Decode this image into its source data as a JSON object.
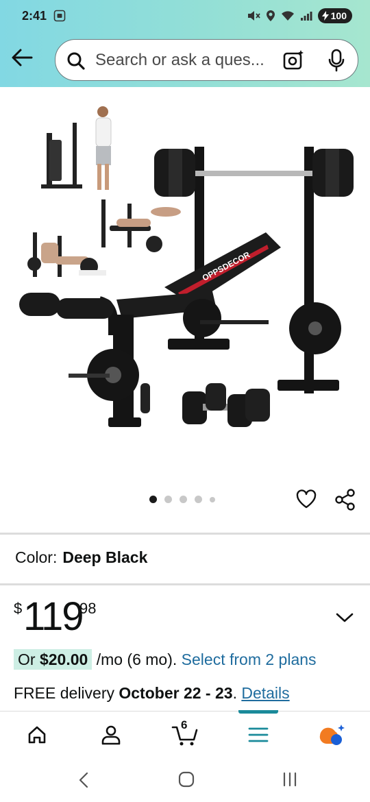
{
  "status_bar": {
    "time": "2:41",
    "battery": "100"
  },
  "search": {
    "placeholder": "Search or ask a ques..."
  },
  "carousel": {
    "total_dots": 5,
    "active_index": 0
  },
  "product": {
    "color_label": "Color:",
    "color_value": "Deep Black",
    "price_symbol": "$",
    "price_whole": "119",
    "price_fraction": "98",
    "monthly_prefix": "Or",
    "monthly_amount": "$20.00",
    "monthly_suffix": "/mo (6 mo).",
    "monthly_link": "Select from 2 plans",
    "delivery_prefix": "FREE delivery",
    "delivery_dates": "October 22 - 23",
    "delivery_sep": ".",
    "delivery_link": "Details",
    "brand_text": "OPPSDECOR"
  },
  "bottom_nav": {
    "items": [
      "home-icon",
      "account-icon",
      "cart-icon",
      "menu-icon",
      "rufus-icon"
    ],
    "cart_count": "6",
    "active": "menu-icon"
  },
  "colors": {
    "accent_teal": "#1a8a9a",
    "link_blue": "#1f6c9e",
    "highlight_green": "#cdeee4"
  }
}
